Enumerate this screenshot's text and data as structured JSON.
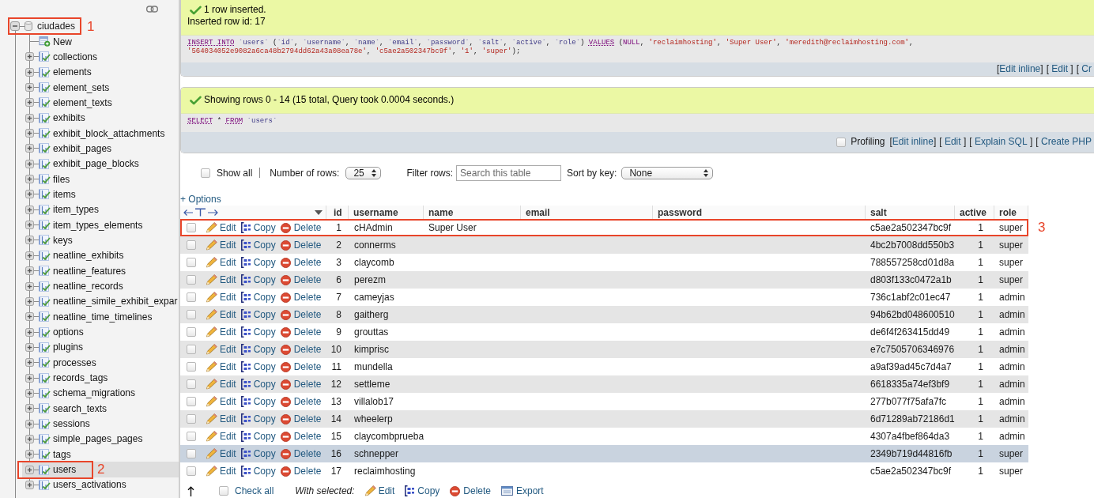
{
  "sidebar": {
    "tree": {
      "label": "ciudades",
      "expanded": true,
      "selected": false,
      "callout": "1",
      "children": [
        {
          "kind": "new",
          "label": "New",
          "selected": false
        },
        {
          "kind": "table",
          "label": "collections",
          "expanded": false,
          "selected": false
        },
        {
          "kind": "table",
          "label": "elements",
          "expanded": false,
          "selected": false
        },
        {
          "kind": "table",
          "label": "element_sets",
          "expanded": false,
          "selected": false
        },
        {
          "kind": "table",
          "label": "element_texts",
          "expanded": false,
          "selected": false
        },
        {
          "kind": "table",
          "label": "exhibits",
          "expanded": false,
          "selected": false
        },
        {
          "kind": "table",
          "label": "exhibit_block_attachments",
          "expanded": false,
          "selected": false
        },
        {
          "kind": "table",
          "label": "exhibit_pages",
          "expanded": false,
          "selected": false
        },
        {
          "kind": "table",
          "label": "exhibit_page_blocks",
          "expanded": false,
          "selected": false
        },
        {
          "kind": "table",
          "label": "files",
          "expanded": false,
          "selected": false
        },
        {
          "kind": "table",
          "label": "items",
          "expanded": false,
          "selected": false
        },
        {
          "kind": "table",
          "label": "item_types",
          "expanded": false,
          "selected": false
        },
        {
          "kind": "table",
          "label": "item_types_elements",
          "expanded": false,
          "selected": false
        },
        {
          "kind": "table",
          "label": "keys",
          "expanded": false,
          "selected": false
        },
        {
          "kind": "table",
          "label": "neatline_exhibits",
          "expanded": false,
          "selected": false
        },
        {
          "kind": "table",
          "label": "neatline_features",
          "expanded": false,
          "selected": false
        },
        {
          "kind": "table",
          "label": "neatline_records",
          "expanded": false,
          "selected": false
        },
        {
          "kind": "table",
          "label": "neatline_simile_exhibit_expar",
          "expanded": false,
          "selected": false
        },
        {
          "kind": "table",
          "label": "neatline_time_timelines",
          "expanded": false,
          "selected": false
        },
        {
          "kind": "table",
          "label": "options",
          "expanded": false,
          "selected": false
        },
        {
          "kind": "table",
          "label": "plugins",
          "expanded": false,
          "selected": false
        },
        {
          "kind": "table",
          "label": "processes",
          "expanded": false,
          "selected": false
        },
        {
          "kind": "table",
          "label": "records_tags",
          "expanded": false,
          "selected": false
        },
        {
          "kind": "table",
          "label": "schema_migrations",
          "expanded": false,
          "selected": false
        },
        {
          "kind": "table",
          "label": "search_texts",
          "expanded": false,
          "selected": false
        },
        {
          "kind": "table",
          "label": "sessions",
          "expanded": false,
          "selected": false
        },
        {
          "kind": "table",
          "label": "simple_pages_pages",
          "expanded": false,
          "selected": false
        },
        {
          "kind": "table",
          "label": "tags",
          "expanded": false,
          "selected": false
        },
        {
          "kind": "table",
          "label": "users",
          "expanded": false,
          "selected": true,
          "callout": "2"
        },
        {
          "kind": "table",
          "label": "users_activations",
          "expanded": false,
          "selected": false
        }
      ]
    }
  },
  "results": [
    {
      "kind": "success",
      "message": [
        "1 row inserted.",
        "Inserted row id: 17"
      ],
      "query": [
        {
          "kind": "keyword",
          "text": "INSERT INTO"
        },
        {
          "kind": "identifier",
          "text": " `users`"
        },
        {
          "kind": "plain",
          "text": " ("
        },
        {
          "kind": "identifier",
          "text": "`id`"
        },
        {
          "kind": "plain",
          "text": ", "
        },
        {
          "kind": "identifier",
          "text": "`username`"
        },
        {
          "kind": "plain",
          "text": ", "
        },
        {
          "kind": "identifier",
          "text": "`name`"
        },
        {
          "kind": "plain",
          "text": ", "
        },
        {
          "kind": "identifier",
          "text": "`email`"
        },
        {
          "kind": "plain",
          "text": ", "
        },
        {
          "kind": "identifier",
          "text": "`password`"
        },
        {
          "kind": "plain",
          "text": ", "
        },
        {
          "kind": "identifier",
          "text": "`salt`"
        },
        {
          "kind": "plain",
          "text": ", "
        },
        {
          "kind": "identifier",
          "text": "`active`"
        },
        {
          "kind": "plain",
          "text": ", "
        },
        {
          "kind": "identifier",
          "text": "`role`"
        },
        {
          "kind": "plain",
          "text": ") "
        },
        {
          "kind": "keyword",
          "text": "VALUES"
        },
        {
          "kind": "plain",
          "text": " ("
        },
        {
          "kind": "literal",
          "text": "NULL"
        },
        {
          "kind": "plain",
          "text": ", "
        },
        {
          "kind": "string",
          "text": "'reclaimhosting'"
        },
        {
          "kind": "plain",
          "text": ", "
        },
        {
          "kind": "string",
          "text": "'Super User'"
        },
        {
          "kind": "plain",
          "text": ", "
        },
        {
          "kind": "string",
          "text": "'meredith@reclaimhosting.com'"
        },
        {
          "kind": "plain",
          "text": ", "
        },
        {
          "kind": "string",
          "text": "'564034052e9082a6ca48b2794dd62a43a08ea78e'"
        },
        {
          "kind": "plain",
          "text": ", "
        },
        {
          "kind": "string",
          "text": "'c5ae2a502347bc9f'"
        },
        {
          "kind": "plain",
          "text": ", "
        },
        {
          "kind": "string",
          "text": "'1'"
        },
        {
          "kind": "plain",
          "text": ", "
        },
        {
          "kind": "string",
          "text": "'super'"
        },
        {
          "kind": "plain",
          "text": ");"
        }
      ],
      "links": [
        {
          "open": "[",
          "label": "Edit inline",
          "close": "]"
        },
        {
          "open": "[ ",
          "label": "Edit",
          "close": " ]"
        },
        {
          "open": "[ ",
          "label": "Cr"
        }
      ]
    },
    {
      "kind": "success",
      "message": [
        "Showing rows 0 - 14 (15 total, Query took 0.0004 seconds.)"
      ],
      "query": [
        {
          "kind": "keyword",
          "text": "SELECT"
        },
        {
          "kind": "plain",
          "text": " * "
        },
        {
          "kind": "keyword",
          "text": "FROM"
        },
        {
          "kind": "identifier",
          "text": " `users`"
        }
      ],
      "profiling": {
        "label": "Profiling",
        "checked": false
      },
      "links": [
        {
          "open": "[",
          "label": "Edit inline",
          "close": "]"
        },
        {
          "open": "[ ",
          "label": "Edit",
          "close": " ]"
        },
        {
          "open": "[ ",
          "label": "Explain SQL",
          "close": " ]"
        },
        {
          "open": "[ ",
          "label": "Create PHP"
        }
      ]
    }
  ],
  "table_controls": {
    "show_all": {
      "label": "Show all",
      "checked": false
    },
    "rows": {
      "label": "Number of rows:",
      "value": "25"
    },
    "filter": {
      "label": "Filter rows:",
      "placeholder": "Search this table"
    },
    "sort": {
      "label": "Sort by key:",
      "value": "None"
    }
  },
  "options_link": "+ Options",
  "table": {
    "columns": [
      "id",
      "username",
      "name",
      "email",
      "password",
      "salt",
      "active",
      "role"
    ],
    "rows": [
      {
        "checked": false,
        "highlighted": false,
        "callout": "3",
        "actions": [
          "Edit",
          "Copy",
          "Delete"
        ],
        "id": "1",
        "username": "cHAdmin",
        "name": "Super User",
        "salt": "c5ae2a502347bc9f",
        "active": "1",
        "role": "super"
      },
      {
        "checked": false,
        "highlighted": false,
        "actions": [
          "Edit",
          "Copy",
          "Delete"
        ],
        "id": "2",
        "username": "connerms",
        "salt": "4bc2b7008dd550b3",
        "active": "1",
        "role": "super"
      },
      {
        "checked": false,
        "highlighted": false,
        "actions": [
          "Edit",
          "Copy",
          "Delete"
        ],
        "id": "3",
        "username": "claycomb",
        "salt": "788557258cd01d8a",
        "active": "1",
        "role": "super"
      },
      {
        "checked": false,
        "highlighted": false,
        "actions": [
          "Edit",
          "Copy",
          "Delete"
        ],
        "id": "6",
        "username": "perezm",
        "salt": "d803f133c0472a1b",
        "active": "1",
        "role": "super"
      },
      {
        "checked": false,
        "highlighted": false,
        "actions": [
          "Edit",
          "Copy",
          "Delete"
        ],
        "id": "7",
        "username": "cameyjas",
        "salt": "736c1abf2c01ec47",
        "active": "1",
        "role": "admin"
      },
      {
        "checked": false,
        "highlighted": false,
        "actions": [
          "Edit",
          "Copy",
          "Delete"
        ],
        "id": "8",
        "username": "gaitherg",
        "salt": "94b62bd048600510",
        "active": "1",
        "role": "admin"
      },
      {
        "checked": false,
        "highlighted": false,
        "actions": [
          "Edit",
          "Copy",
          "Delete"
        ],
        "id": "9",
        "username": "grouttas",
        "salt": "de6f4f263415dd49",
        "active": "1",
        "role": "admin"
      },
      {
        "checked": false,
        "highlighted": false,
        "actions": [
          "Edit",
          "Copy",
          "Delete"
        ],
        "id": "10",
        "username": "kimprisc",
        "salt": "e7c7505706346976",
        "active": "1",
        "role": "admin"
      },
      {
        "checked": false,
        "highlighted": false,
        "actions": [
          "Edit",
          "Copy",
          "Delete"
        ],
        "id": "11",
        "username": "mundella",
        "salt": "a9af39ad45c7d4a7",
        "active": "1",
        "role": "admin"
      },
      {
        "checked": false,
        "highlighted": false,
        "actions": [
          "Edit",
          "Copy",
          "Delete"
        ],
        "id": "12",
        "username": "settleme",
        "salt": "6618335a74ef3bf9",
        "active": "1",
        "role": "admin"
      },
      {
        "checked": false,
        "highlighted": false,
        "actions": [
          "Edit",
          "Copy",
          "Delete"
        ],
        "id": "13",
        "username": "villalob17",
        "salt": "277b077f75afa7fc",
        "active": "1",
        "role": "admin"
      },
      {
        "checked": false,
        "highlighted": false,
        "actions": [
          "Edit",
          "Copy",
          "Delete"
        ],
        "id": "14",
        "username": "wheelerp",
        "salt": "6d71289ab72186d1",
        "active": "1",
        "role": "admin"
      },
      {
        "checked": false,
        "highlighted": false,
        "actions": [
          "Edit",
          "Copy",
          "Delete"
        ],
        "id": "15",
        "username": "claycombprueba",
        "salt": "4307a4fbef864da3",
        "active": "1",
        "role": "admin"
      },
      {
        "checked": false,
        "highlighted": true,
        "actions": [
          "Edit",
          "Copy",
          "Delete"
        ],
        "id": "16",
        "username": "schnepper",
        "salt": "2349b719d44816fb",
        "active": "1",
        "role": "super"
      },
      {
        "checked": false,
        "highlighted": false,
        "actions": [
          "Edit",
          "Copy",
          "Delete"
        ],
        "id": "17",
        "username": "reclaimhosting",
        "salt": "c5ae2a502347bc9f",
        "active": "1",
        "role": "super"
      }
    ]
  },
  "footer": {
    "check_all": {
      "label": "Check all",
      "checked": false
    },
    "with_selected": "With selected:",
    "actions": [
      "Edit",
      "Copy",
      "Delete",
      "Export"
    ]
  }
}
